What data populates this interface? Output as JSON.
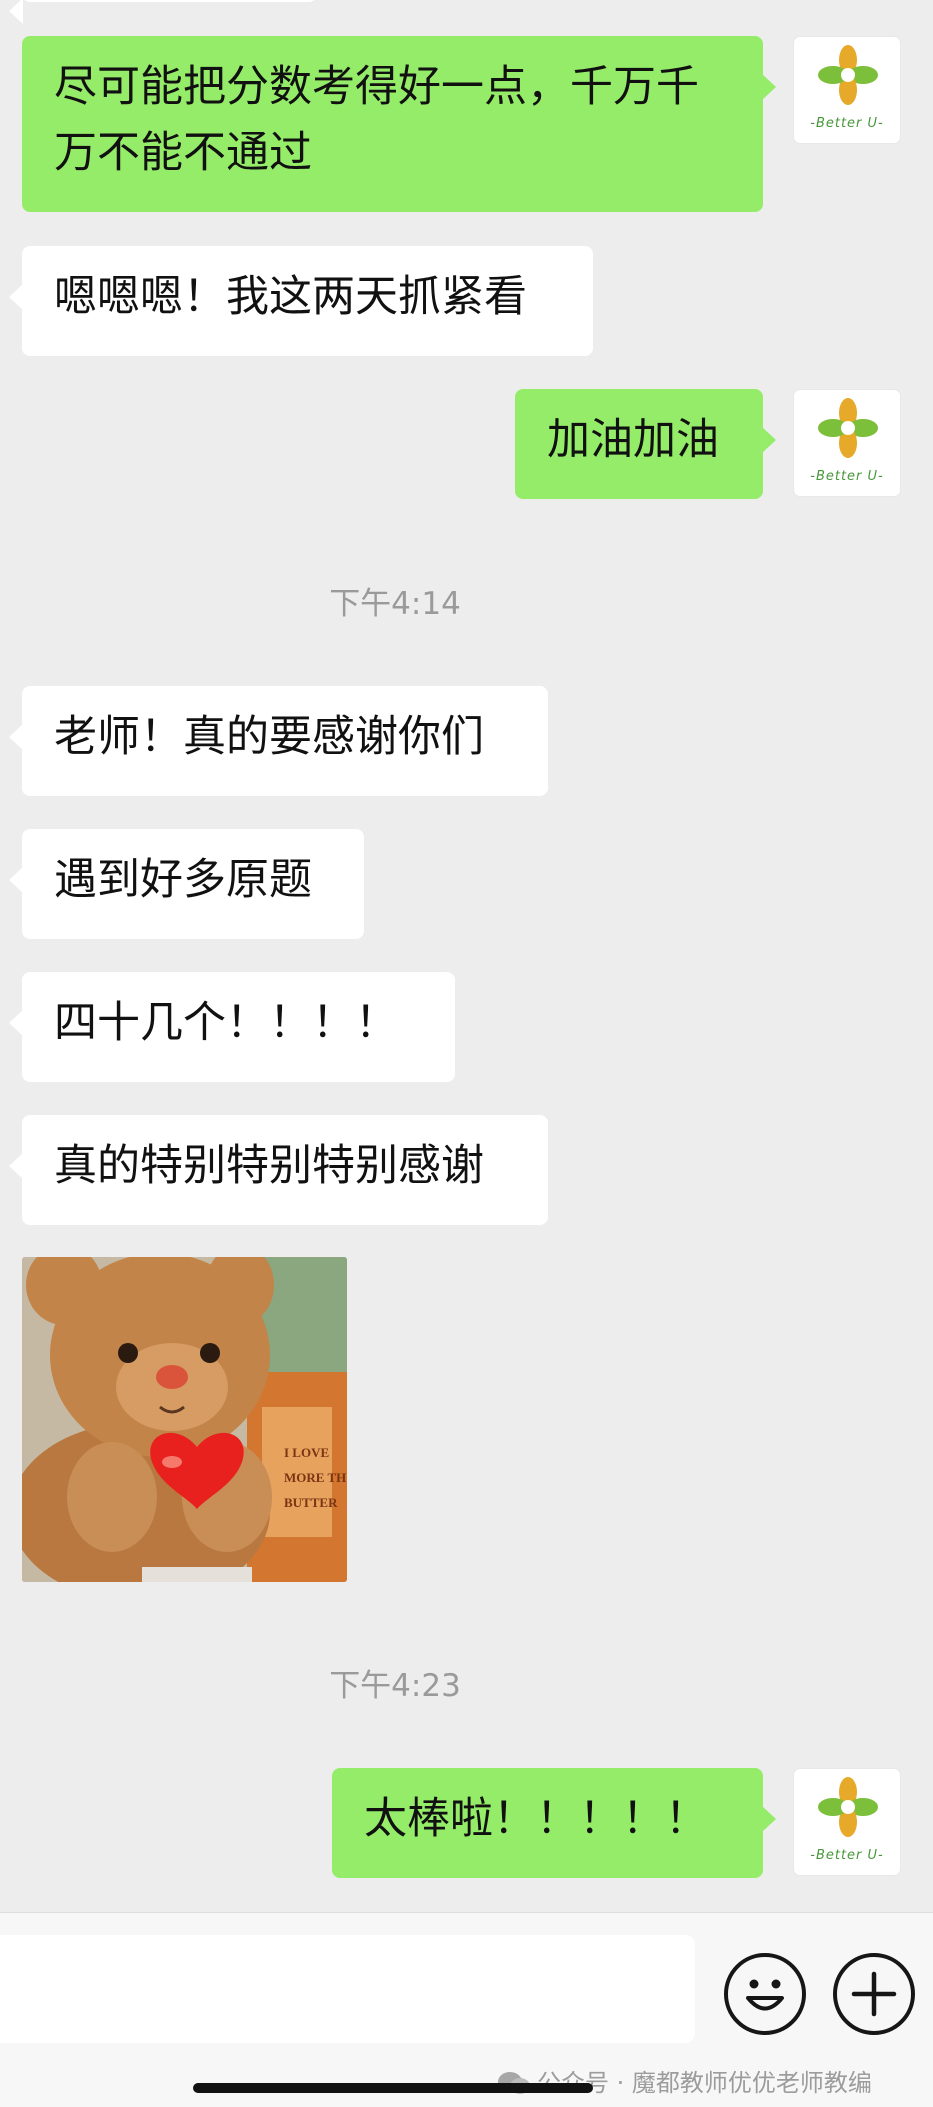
{
  "conversation": {
    "messages": [
      {
        "side": "right",
        "text_lines": [
          "尽可能把分数考得好一点，千万千",
          "万不能不通过"
        ]
      },
      {
        "side": "left",
        "text": "嗯嗯嗯！我这两天抓紧看"
      },
      {
        "side": "right",
        "text": "加油加油"
      },
      {
        "type": "timestamp",
        "text": "下午4:14"
      },
      {
        "side": "left",
        "text": "老师！真的要感谢你们"
      },
      {
        "side": "left",
        "text": "遇到好多原题"
      },
      {
        "side": "left",
        "text": "四十几个！！！！"
      },
      {
        "side": "left",
        "text": "真的特别特别特别感谢"
      },
      {
        "side": "left",
        "type": "sticker",
        "sticker_lettering": "I LOVE MORE THAN BUTTER"
      },
      {
        "type": "timestamp",
        "text": "下午4:23"
      },
      {
        "side": "right",
        "text": "太棒啦！！！！！"
      }
    ]
  },
  "avatar": {
    "brand_text": "-Better U-"
  },
  "input_bar": {
    "emoji_icon": "emoji-smile-icon",
    "more_icon": "plus-circle-icon"
  },
  "watermark": {
    "text": "公众号 · 魔都教师优优老师教编"
  },
  "colors": {
    "background": "#ededed",
    "bubble_sent": "#95ec69",
    "bubble_received": "#ffffff",
    "timestamp": "#9a9a9a"
  }
}
